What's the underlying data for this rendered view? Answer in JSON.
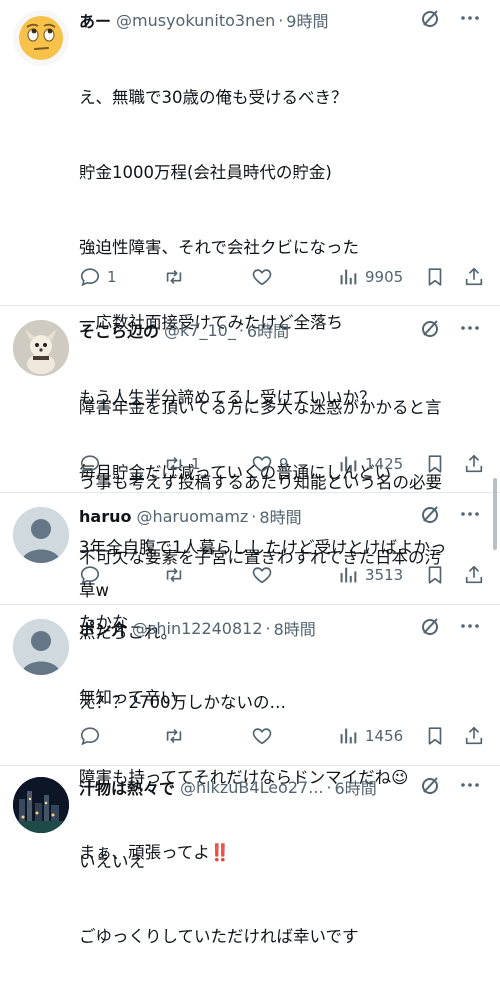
{
  "tweets": [
    {
      "name": "あー",
      "handle": "@musyokunito3nen",
      "time": "9時間",
      "lines": [
        "え、無職で30歳の俺も受けるべき？",
        "貯金1000万程(会社員時代の貯金)",
        "強迫性障害、それで会社クビになった",
        "一応数社面接受けてみたけど全落ち",
        "もう人生半分諦めてるし受けていいか？",
        "毎月貯金だけ減っていくの普通にしんどい",
        "3年全自腹で1人暮らししたけど受けとけばよかっ",
        "たかな",
        "無知って辛い"
      ],
      "replies": "1",
      "retweets": "",
      "likes": "",
      "views": "9905",
      "avatar": "emoji"
    },
    {
      "name": "そこら辺の",
      "handle": "@k7_10_",
      "time": "6時間",
      "lines": [
        "障害年金を頂いてる方に多大な迷惑がかかると言",
        "う事も考えず投稿するあたり知能という名の必要",
        "不可欠な要素を子宮に置きわすれてきた日本の汚",
        "点だろこれ。"
      ],
      "replies": "",
      "retweets": "1",
      "likes": "9",
      "views": "1425",
      "avatar": "dog"
    },
    {
      "name": "haruo",
      "handle": "@haruomamz",
      "time": "8時間",
      "lines": [
        "草w"
      ],
      "replies": "",
      "retweets": "",
      "likes": "",
      "views": "3513",
      "avatar": "default"
    },
    {
      "name": "ポン介",
      "handle": "@shin12240812",
      "time": "8時間",
      "lines": [
        "え？？2700万しかないの…",
        "障害も持っててそれだけならドンマイだね😉",
        "まぁ、頑張ってよ‼️"
      ],
      "replies": "",
      "retweets": "",
      "likes": "",
      "views": "1456",
      "avatar": "default"
    },
    {
      "name": "汁物は熱々で",
      "handle": "@hlkzuB4Leo27...",
      "time": "6時間",
      "lines": [
        "いえいえ",
        "ごゆっくりしていただければ幸いです"
      ],
      "replies": "",
      "retweets": "",
      "likes": "",
      "views": "",
      "avatar": "night"
    }
  ],
  "colors": {
    "text": "#0f1419",
    "muted": "#536471",
    "divider": "#e6e9eb"
  },
  "icons": [
    "reply-icon",
    "retweet-icon",
    "like-icon",
    "views-icon",
    "bookmark-icon",
    "share-icon",
    "mute-icon",
    "more-icon"
  ]
}
